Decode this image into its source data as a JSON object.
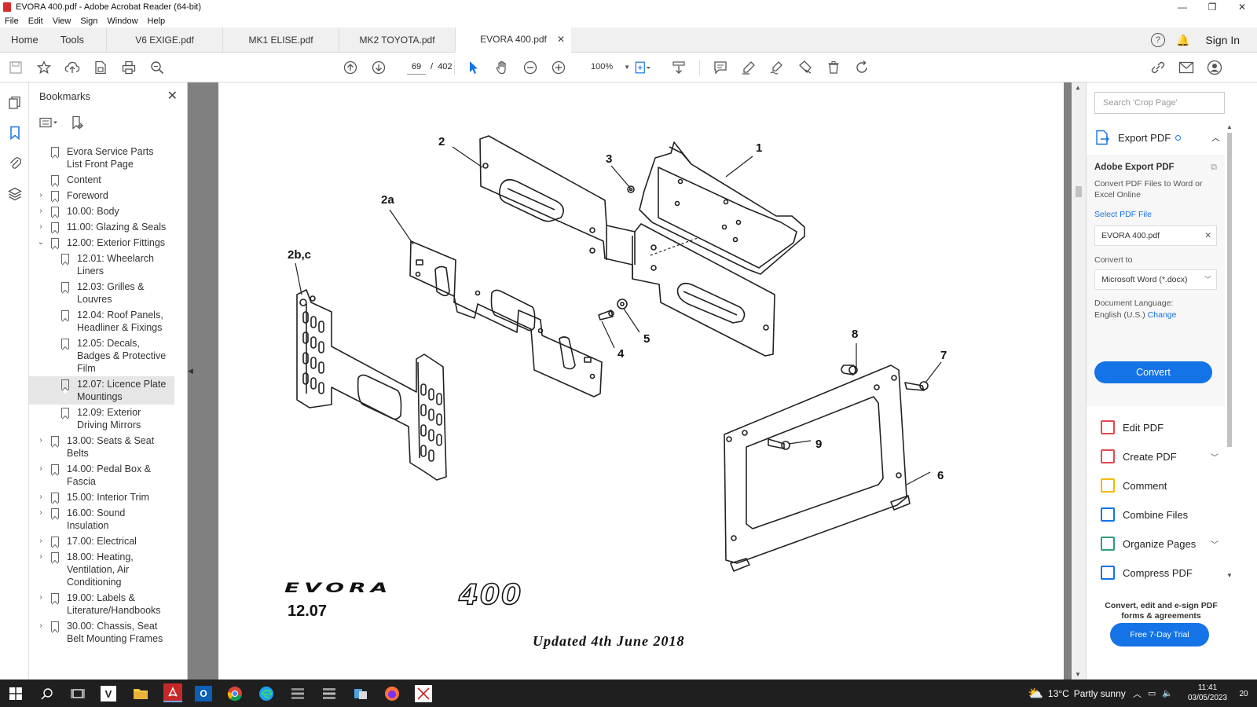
{
  "window": {
    "title": "EVORA 400.pdf - Adobe Acrobat Reader (64-bit)",
    "controls": [
      "—",
      "❐",
      "✕"
    ]
  },
  "menu": [
    "File",
    "Edit",
    "View",
    "Sign",
    "Window",
    "Help"
  ],
  "nav": {
    "home": "Home",
    "tools": "Tools",
    "tabs": [
      {
        "label": "V6 EXIGE.pdf",
        "active": false
      },
      {
        "label": "MK1 ELISE.pdf",
        "active": false
      },
      {
        "label": "MK2 TOYOTA.pdf",
        "active": false
      },
      {
        "label": "EVORA 400.pdf",
        "active": true
      }
    ],
    "help": "?",
    "sign_in": "Sign In"
  },
  "toolbar": {
    "current_page": "69",
    "page_separator": "/",
    "total_pages": "402",
    "zoom": "100%"
  },
  "bookmarks": {
    "title": "Bookmarks",
    "items": [
      {
        "label": "Evora Service Parts List Front Page",
        "expand": "",
        "child": false,
        "selected": false
      },
      {
        "label": "Content",
        "expand": "",
        "child": false,
        "selected": false
      },
      {
        "label": "Foreword",
        "expand": "›",
        "child": false,
        "selected": false
      },
      {
        "label": "10.00: Body",
        "expand": "›",
        "child": false,
        "selected": false
      },
      {
        "label": "11.00: Glazing & Seals",
        "expand": "›",
        "child": false,
        "selected": false
      },
      {
        "label": "12.00: Exterior Fittings",
        "expand": "⌄",
        "child": false,
        "selected": false
      },
      {
        "label": "12.01: Wheelarch Liners",
        "expand": "",
        "child": true,
        "selected": false
      },
      {
        "label": "12.03: Grilles & Louvres",
        "expand": "",
        "child": true,
        "selected": false
      },
      {
        "label": "12.04: Roof Panels, Headliner & Fixings",
        "expand": "",
        "child": true,
        "selected": false
      },
      {
        "label": "12.05: Decals, Badges & Protective Film",
        "expand": "",
        "child": true,
        "selected": false
      },
      {
        "label": "12.07: Licence Plate Mountings",
        "expand": "",
        "child": true,
        "selected": true
      },
      {
        "label": "12.09: Exterior Driving Mirrors",
        "expand": "",
        "child": true,
        "selected": false
      },
      {
        "label": "13.00: Seats  & Seat Belts",
        "expand": "›",
        "child": false,
        "selected": false
      },
      {
        "label": "14.00: Pedal Box & Fascia",
        "expand": "›",
        "child": false,
        "selected": false
      },
      {
        "label": "15.00: Interior Trim",
        "expand": "›",
        "child": false,
        "selected": false
      },
      {
        "label": "16.00: Sound Insulation",
        "expand": "›",
        "child": false,
        "selected": false
      },
      {
        "label": "17.00: Electrical",
        "expand": "›",
        "child": false,
        "selected": false
      },
      {
        "label": "18.00: Heating, Ventilation, Air Conditioning",
        "expand": "›",
        "child": false,
        "selected": false
      },
      {
        "label": "19.00: Labels & Literature/Handbooks",
        "expand": "›",
        "child": false,
        "selected": false
      },
      {
        "label": "30.00: Chassis, Seat Belt Mounting Frames",
        "expand": "›",
        "child": false,
        "selected": false
      }
    ]
  },
  "page": {
    "callouts": [
      "1",
      "2",
      "2a",
      "2b,c",
      "3",
      "4",
      "5",
      "6",
      "7",
      "8",
      "9"
    ],
    "brand_evora": "EVORA",
    "brand_400": "400",
    "section": "12.07",
    "updated": "Updated 4th June 2018"
  },
  "right_pane": {
    "search_placeholder": "Search 'Crop Page'",
    "export_header": "Export PDF",
    "export": {
      "title": "Adobe Export PDF",
      "desc": "Convert PDF Files to Word or Excel Online",
      "select_file": "Select PDF File",
      "file_name": "EVORA 400.pdf",
      "convert_to_label": "Convert to",
      "convert_to_value": "Microsoft Word (*.docx)",
      "lang_label": "Document Language:",
      "lang_value": "English (U.S.)",
      "lang_change": "Change",
      "convert_button": "Convert"
    },
    "tools": [
      {
        "label": "Edit PDF",
        "color": "#e34850",
        "chevron": false
      },
      {
        "label": "Create PDF",
        "color": "#e34850",
        "chevron": true
      },
      {
        "label": "Comment",
        "color": "#f5b800",
        "chevron": false
      },
      {
        "label": "Combine Files",
        "color": "#1473e6",
        "chevron": false
      },
      {
        "label": "Organize Pages",
        "color": "#2d9d78",
        "chevron": true
      },
      {
        "label": "Compress PDF",
        "color": "#1473e6",
        "chevron": false
      }
    ],
    "promo": "Convert, edit and e-sign PDF forms & agreements",
    "trial_button": "Free 7-Day Trial"
  },
  "taskbar": {
    "weather_temp": "13°C",
    "weather_desc": "Partly sunny",
    "time": "11:41",
    "date": "03/05/2023",
    "notifications": "20"
  }
}
